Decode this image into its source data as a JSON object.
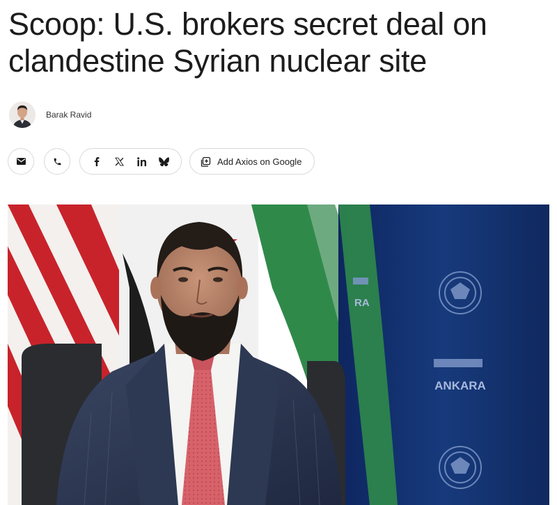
{
  "article": {
    "headline_line1": "Scoop: U.S. brokers secret deal on",
    "headline_line2": "clandestine Syrian nuclear site",
    "author": "Barak Ravid"
  },
  "share": {
    "icons": [
      "email-icon",
      "phone-icon",
      "facebook-icon",
      "x-icon",
      "linkedin-icon",
      "bluesky-icon",
      "add-source-icon"
    ],
    "add_google_label": "Add Axios on Google"
  },
  "hero_image": {
    "backdrop_text_1": "ANKARA",
    "backdrop_text_2": "RA"
  },
  "colors": {
    "text": "#1c1c1c",
    "border": "#d9d9d9",
    "navy_backdrop": "#14326e",
    "flag_green": "#2f8a4a",
    "flag_red": "#c8232b",
    "tie": "#d7626a"
  }
}
